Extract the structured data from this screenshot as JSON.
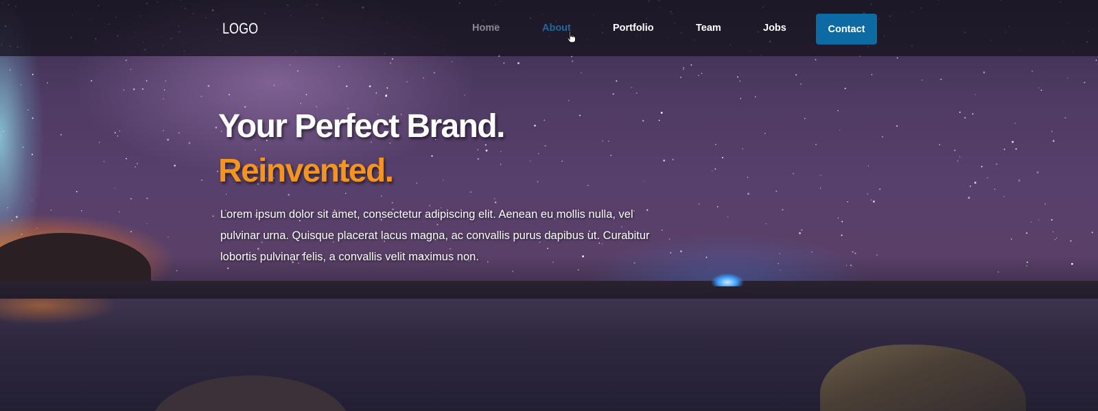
{
  "nav": {
    "logo": "LOGO",
    "links": [
      {
        "label": "Home",
        "state": "dim"
      },
      {
        "label": "About",
        "state": "active-hover"
      },
      {
        "label": "Portfolio",
        "state": "normal"
      },
      {
        "label": "Team",
        "state": "normal"
      },
      {
        "label": "Jobs",
        "state": "normal"
      }
    ],
    "contact_label": "Contact"
  },
  "hero": {
    "headline": "Your Perfect Brand.",
    "subheadline": "Reinvented.",
    "lead": "Lorem ipsum dolor sit amet, consectetur adipiscing elit. Aenean eu mollis nulla, vel pulvinar urna. Quisque placerat lacus magna, ac convallis purus dapibus ut. Curabitur lobortis pulvinar felis, a convallis velit maximus non."
  },
  "colors": {
    "accent_orange": "#f7941d",
    "button_blue": "#0d6aa2",
    "active_link": "#1e6aa0",
    "navbar_bg": "rgba(18,16,26,0.72)"
  },
  "icons": {
    "cursor": "hand-pointer-icon"
  }
}
